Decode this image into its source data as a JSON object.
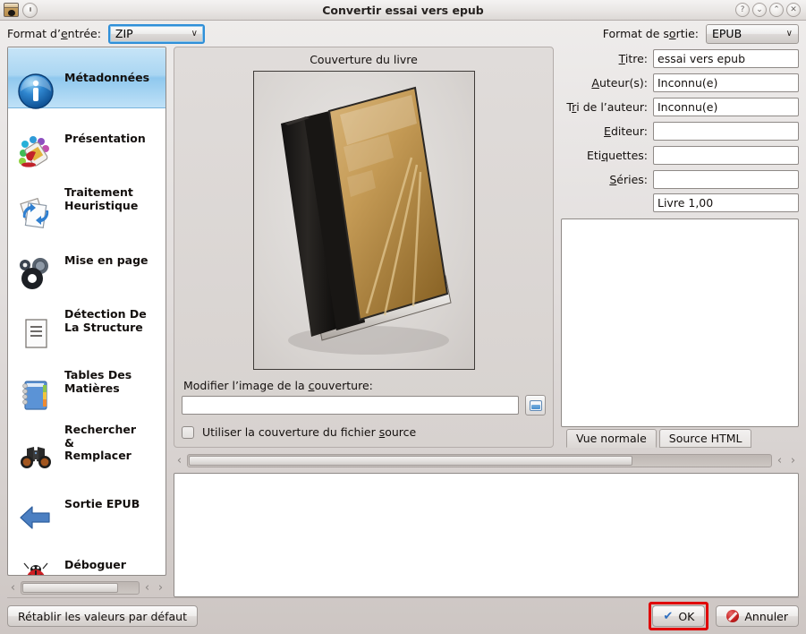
{
  "window": {
    "title": "Convertir essai vers epub",
    "controls": [
      {
        "name": "help",
        "glyph": "?"
      },
      {
        "name": "minimize",
        "glyph": "⌄"
      },
      {
        "name": "maximize",
        "glyph": "⌃"
      },
      {
        "name": "close",
        "glyph": "✕"
      }
    ],
    "app_icon": "book-app-icon"
  },
  "format_bar": {
    "input_label_pre": "Format d’",
    "input_label_accel": "e",
    "input_label_post": "ntrée:",
    "input_value": "ZIP",
    "output_label_pre": "Format de s",
    "output_label_accel": "o",
    "output_label_post": "rtie:",
    "output_value": "EPUB",
    "arrow": "∨"
  },
  "sidebar": {
    "items": [
      {
        "label": "Métadonnées",
        "icon": "info-icon",
        "selected": true
      },
      {
        "label": "Présentation",
        "icon": "paint-bucket-icon",
        "selected": false
      },
      {
        "label": "Traitement\nHeuristique",
        "icon": "refresh-page-icon",
        "selected": false
      },
      {
        "label": "Mise en page",
        "icon": "gears-icon",
        "selected": false
      },
      {
        "label": "Détection De\nLa Structure",
        "icon": "document-lines-icon",
        "selected": false
      },
      {
        "label": "Tables Des\nMatières",
        "icon": "notebook-icon",
        "selected": false
      },
      {
        "label": "Rechercher\n&\nRemplacer",
        "icon": "binoculars-icon",
        "selected": false
      },
      {
        "label": "Sortie EPUB",
        "icon": "blue-arrow-left-icon",
        "selected": false
      },
      {
        "label": "Déboguer",
        "icon": "ladybug-icon",
        "selected": false
      }
    ],
    "scroll_left_arrow": "‹",
    "scroll_right_arrow": "›",
    "scroll_thumb_percent": 82
  },
  "cover_group": {
    "title": "Couverture du livre",
    "cover_image": "book-cover-thumbnail",
    "change_cover_label_pre": "Modifier l’image de la ",
    "change_cover_label_accel": "c",
    "change_cover_label_post": "ouverture:",
    "cover_path_value": "",
    "browse_icon": "open-folder-icon",
    "use_source_cover_pre": "Utiliser la couverture du fichier ",
    "use_source_cover_accel": "s",
    "use_source_cover_post": "ource",
    "use_source_cover_checked": false
  },
  "metadata": {
    "fields": [
      {
        "label_pre": "",
        "label_accel": "T",
        "label_post": "itre:",
        "value": "essai vers epub",
        "name": "title"
      },
      {
        "label_pre": "",
        "label_accel": "A",
        "label_post": "uteur(s):",
        "value": "Inconnu(e)",
        "name": "authors"
      },
      {
        "label_pre": "T",
        "label_accel": "r",
        "label_post": "i de l’auteur:",
        "value": "Inconnu(e)",
        "name": "author-sort"
      },
      {
        "label_pre": "",
        "label_accel": "E",
        "label_post": "diteur:",
        "value": "",
        "name": "publisher"
      },
      {
        "label_pre": "Eti",
        "label_accel": "q",
        "label_post": "uettes:",
        "value": "",
        "name": "tags"
      },
      {
        "label_pre": "",
        "label_accel": "S",
        "label_post": "éries:",
        "value": "",
        "name": "series"
      }
    ],
    "series_index_value": "Livre 1,00",
    "comments_value": "",
    "tabs": [
      {
        "label": "Vue normale",
        "active": true
      },
      {
        "label": "Source HTML",
        "active": false
      }
    ]
  },
  "scrollbars": {
    "left_arrow": "‹",
    "right_arrow": "›",
    "main_thumb_percent": 76
  },
  "log": {
    "value": ""
  },
  "footer": {
    "restore_defaults": "Rétablir les valeurs par défaut",
    "ok": "OK",
    "ok_icon": "✔",
    "cancel": "Annuler",
    "cancel_icon": "cancel-icon",
    "ok_highlighted": true
  },
  "colors": {
    "accent_blue": "#2f8fd8",
    "selection_blue": "#aad6f2",
    "highlight_red": "#e00000",
    "window_bg": "#d7d2cf"
  }
}
